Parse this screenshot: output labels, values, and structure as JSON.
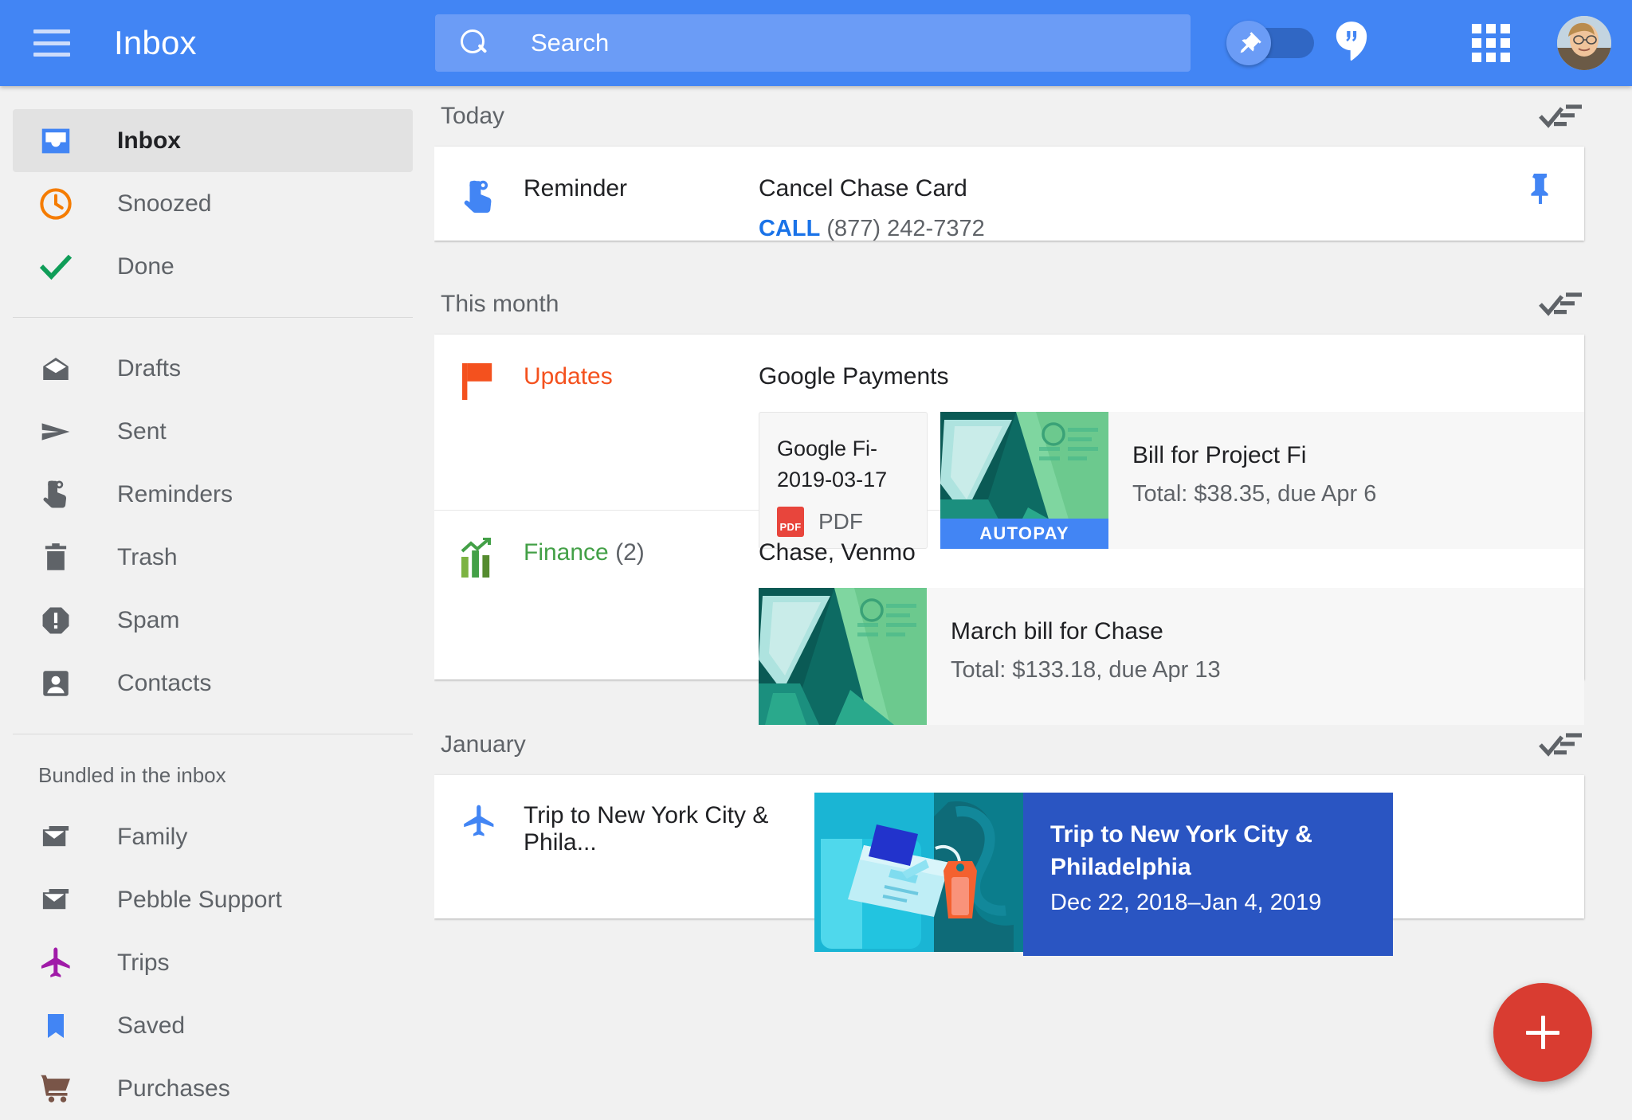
{
  "header": {
    "menu_icon": "hamburger-menu-icon",
    "title": "Inbox",
    "search_placeholder": "Search",
    "search_value": "",
    "search_icon": "search-icon",
    "pin_toggle_icon": "pin-icon",
    "pin_toggle_state": "on",
    "hangouts_icon": "hangouts-quote-icon",
    "apps_icon": "apps-grid-icon",
    "avatar": "user-avatar"
  },
  "sidebar": {
    "primary": [
      {
        "label": "Inbox",
        "icon": "inbox-icon",
        "selected": true
      },
      {
        "label": "Snoozed",
        "icon": "clock-icon",
        "selected": false
      },
      {
        "label": "Done",
        "icon": "checkmark-icon",
        "selected": false
      }
    ],
    "secondary": [
      {
        "label": "Drafts",
        "icon": "draft-envelope-icon"
      },
      {
        "label": "Sent",
        "icon": "send-paper-plane-icon"
      },
      {
        "label": "Reminders",
        "icon": "finger-string-icon"
      },
      {
        "label": "Trash",
        "icon": "trash-can-icon"
      },
      {
        "label": "Spam",
        "icon": "spam-exclamation-icon"
      },
      {
        "label": "Contacts",
        "icon": "person-contact-icon"
      }
    ],
    "bundled_header": "Bundled in the inbox",
    "bundles": [
      {
        "label": "Family",
        "icon": "stacked-envelope-icon"
      },
      {
        "label": "Pebble Support",
        "icon": "stacked-envelope-icon"
      },
      {
        "label": "Trips",
        "icon": "airplane-icon"
      },
      {
        "label": "Saved",
        "icon": "bookmark-icon"
      },
      {
        "label": "Purchases",
        "icon": "shopping-cart-icon"
      }
    ]
  },
  "main": {
    "groups": [
      {
        "title": "Today",
        "sweep_icon": "sweep-done-icon",
        "items": [
          {
            "kind": "reminder",
            "icon": "reminder-finger-icon",
            "label": "Reminder",
            "title": "Cancel Chase Card",
            "call_label": "CALL",
            "phone": "(877) 242-7372",
            "pin_icon": "pin-icon"
          }
        ]
      },
      {
        "title": "This month",
        "sweep_icon": "sweep-done-icon",
        "items": [
          {
            "kind": "bundle",
            "icon": "orange-flag-icon",
            "label": "Updates",
            "count": "",
            "senders": "Google Payments",
            "attachment": {
              "filename": "Google Fi-2019-03-17",
              "type_badge": "PDF",
              "type_label": "PDF"
            },
            "bill": {
              "thumb_icon": "bill-illustration",
              "badge": "AUTOPAY",
              "title": "Bill for Project Fi",
              "subtitle": "Total: $38.35, due Apr 6"
            }
          },
          {
            "kind": "bundle",
            "icon": "green-finance-chart-icon",
            "label": "Finance",
            "count": "(2)",
            "senders": "Chase, Venmo",
            "bill": {
              "thumb_icon": "bill-illustration",
              "badge": "",
              "title": "March bill for Chase",
              "subtitle": "Total: $133.18, due Apr 13"
            }
          }
        ]
      },
      {
        "title": "January",
        "sweep_icon": "sweep-done-icon",
        "items": [
          {
            "kind": "trip",
            "icon": "airplane-icon",
            "label": "Trip to New York City & Phila...",
            "trip_title": "Trip to New York City & Philadelphia",
            "trip_dates": "Dec 22, 2018–Jan 4, 2019",
            "photo_icon": "luggage-ticket-illustration"
          }
        ]
      }
    ],
    "fab": {
      "icon": "plus-icon",
      "label": "Compose"
    }
  },
  "colors": {
    "brand_blue": "#4285f4",
    "accent_red": "#d93c31",
    "flag_orange": "#f4511e",
    "finance_green": "#43a047",
    "trips_purple": "#a01ba8",
    "saved_blue": "#4285f4",
    "purchases_brown": "#795548",
    "snoozed_orange": "#f57c00",
    "done_green": "#0f9d58",
    "trip_panel_blue": "#2a55c2"
  }
}
